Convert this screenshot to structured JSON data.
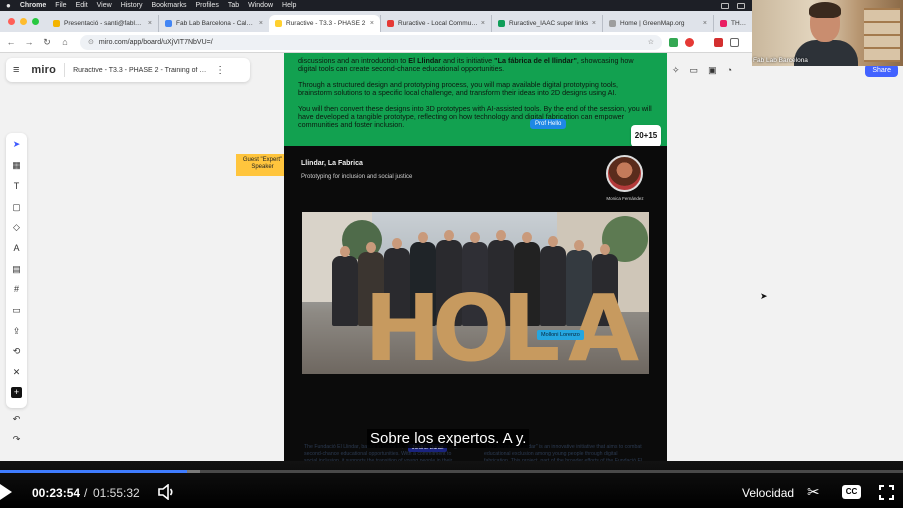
{
  "menubar": {
    "app": "Chrome",
    "items": [
      "File",
      "Edit",
      "View",
      "History",
      "Bookmarks",
      "Profiles",
      "Tab",
      "Window",
      "Help"
    ]
  },
  "tabs": [
    {
      "label": "Presentació - santi@fablabb",
      "color": "#f4b400"
    },
    {
      "label": "Fab Lab Barcelona - Calend",
      "color": "#4285f4"
    },
    {
      "label": "Ruractive - T3.3 - PHASE 2",
      "color": "#ffd02f"
    },
    {
      "label": "Ruractive - Local Community",
      "color": "#e53935"
    },
    {
      "label": "Ruractive_IAAC super links",
      "color": "#0f9d58"
    },
    {
      "label": "Home | GreenMap.org",
      "color": "#9e9e9e"
    },
    {
      "label": "THE PRO",
      "color": "#e91e63"
    }
  ],
  "address": {
    "url": "miro.com/app/board/uXjVIT7NbVU=/"
  },
  "miro": {
    "logo": "miro",
    "board_name": "Ruractive - T3.3 - PHASE 2 - Training of LCTs",
    "share_label": "Share"
  },
  "slide_green": {
    "line1_a": "discussions and an introduction to ",
    "line1_b": "El Llindar",
    "line1_c": " and its initiative ",
    "line1_d": "\"La fábrica de el llindar\"",
    "line1_e": ", showcasing how digital tools can create second-chance educational opportunities.",
    "para2": "Through a structured design and prototyping process, you will map available digital prototyping tools, brainstorm solutions to a specific local challenge, and transform their ideas into 2D designs using AI.",
    "para3": "You will then convert these designs into 3D prototypes with AI-assisted tools. By the end of the session, you will have developed a tangible prototype, reflecting on how technology and digital fabrication can empower communities and foster inclusion."
  },
  "prof_hello": "Prof Hello",
  "counter_tag": "20+15",
  "sticky": {
    "line1": "Guest \"Expert\"",
    "line2": "Speaker"
  },
  "slide_dark": {
    "title": "Llindar, La Fabrica",
    "subtitle": "Prototyping for inclusion and social justice",
    "avatar_name": "Monica Fernández",
    "photo_word": [
      "H",
      "O",
      "L",
      "A"
    ],
    "cursor_tag": "Molloni Lorenzo",
    "name_tag": "Jordi L. Duran",
    "col_left": "The Fundació El Llindar, based in Cornellà, is a pioneer in creating second-chance educational opportunities. With a commitment to social inclusion, it supports the transition of young people in their transition to adulthood, helping them return to the educational system or enter the job market with improved prospects. The success of its Llindar model and its ability to adapt to the territory make it a reference for practices that address the needs of young people today.",
    "col_right": "\"La Fàbrica del Llindar\" is an innovative initiative that aims to combat educational exclusion among young people through digital fabrication. This project, part of the broader efforts of the Fundació El Llindar, provides a unique learning environment where students and young adults who have been marginalized from traditional educational systems can acquire practical skills in technology, creativity and collaboration, and contribute to their communities."
  },
  "webcam": {
    "label": "Fab Lab Barcelona"
  },
  "player": {
    "caption": "Sobre los expertos. A y.",
    "current_time": "00:23:54",
    "separator": "/",
    "total_time": "01:55:32",
    "progress_fraction": 0.207,
    "buffer_fraction": 0.221,
    "speed_label": "Velocidad",
    "cc_label": "CC",
    "accent": "#3f7cff"
  }
}
